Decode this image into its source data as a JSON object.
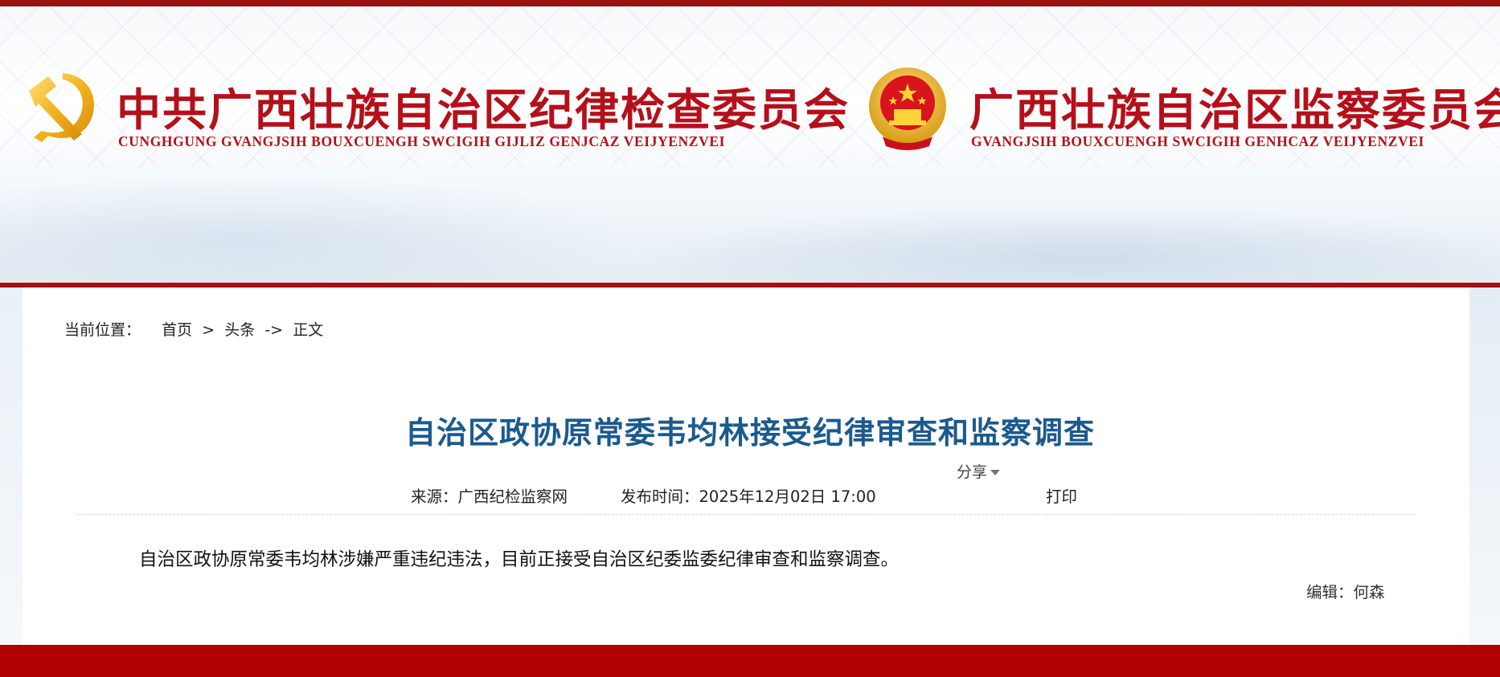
{
  "header": {
    "left": {
      "title_cn": "中共广西壮族自治区纪律检查委员会",
      "title_en": "CUNGHGUNG GVANGJSIH BOUXCUENGH SWCIGIH GIJLIZ GENJCAZ VEIJYENZVEI",
      "logo_icon": "party-emblem-icon"
    },
    "right": {
      "title_cn": "广西壮族自治区监察委员会",
      "title_en": "GVANGJSIH BOUXCUENGH SWCIGIH GENHCAZ VEIJYENZVEI",
      "logo_icon": "national-emblem-icon"
    }
  },
  "breadcrumb": {
    "label": "当前位置：",
    "home": "首页",
    "sep1": " > ",
    "section": "头条",
    "sep2": " -> ",
    "current": "正文"
  },
  "article": {
    "title": "自治区政协原常委韦均林接受纪律审查和监察调查",
    "source": "来源：广西纪检监察网",
    "publish_time": "发布时间：2025年12月02日 17:00",
    "share_label": "分享",
    "print_label": "打印",
    "body": "自治区政协原常委韦均林涉嫌严重违纪违法，目前正接受自治区纪委监委纪律审查和监察调查。",
    "editor": "编辑：何森"
  },
  "colors": {
    "brand_red": "#b5101a",
    "title_blue": "#1b5a8e",
    "footer_red": "#b00000"
  }
}
